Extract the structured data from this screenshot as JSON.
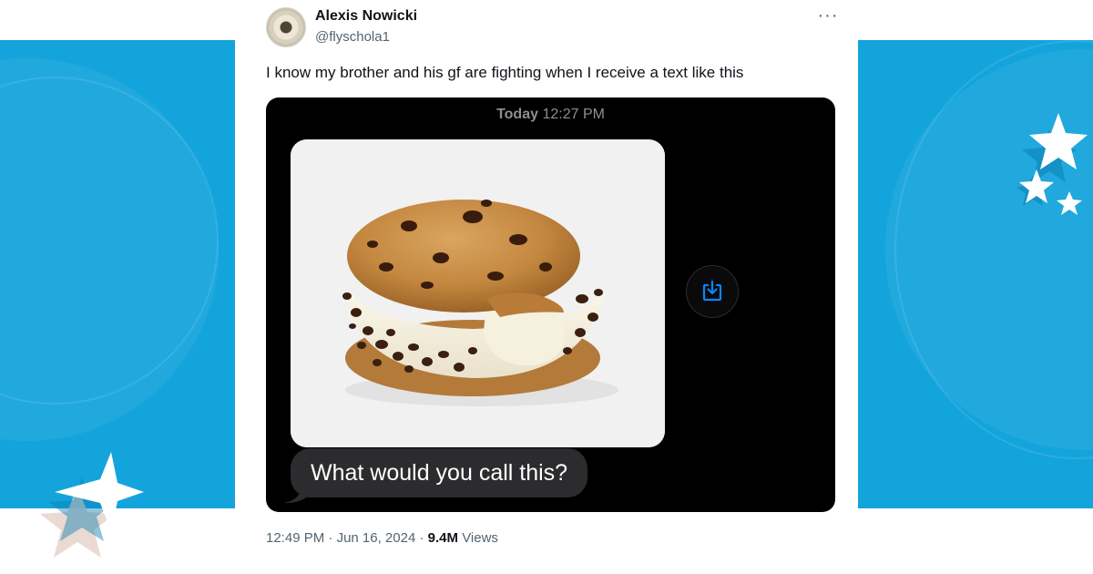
{
  "colors": {
    "background_panel": "#14a4dc",
    "media_background": "#000000",
    "bubble": "#2c2c2e",
    "save_icon": "#0a84ff",
    "star": "#ffffff"
  },
  "tweet": {
    "author_name": "Alexis Nowicki",
    "author_handle": "@flyschola1",
    "more_label": "···",
    "text": "I know my brother and his gf are fighting when I receive a text like this",
    "posted_time": "12:49 PM",
    "posted_date": "Jun 16, 2024",
    "separator": "·",
    "views_count": "9.4M",
    "views_label": "Views"
  },
  "message_screenshot": {
    "day_label": "Today",
    "time_label": "12:27 PM",
    "image_subject": "ice cream cookie sandwich with chocolate chips",
    "save_icon": "save-to-photos-icon",
    "bubble_text": "What would you call this?"
  }
}
